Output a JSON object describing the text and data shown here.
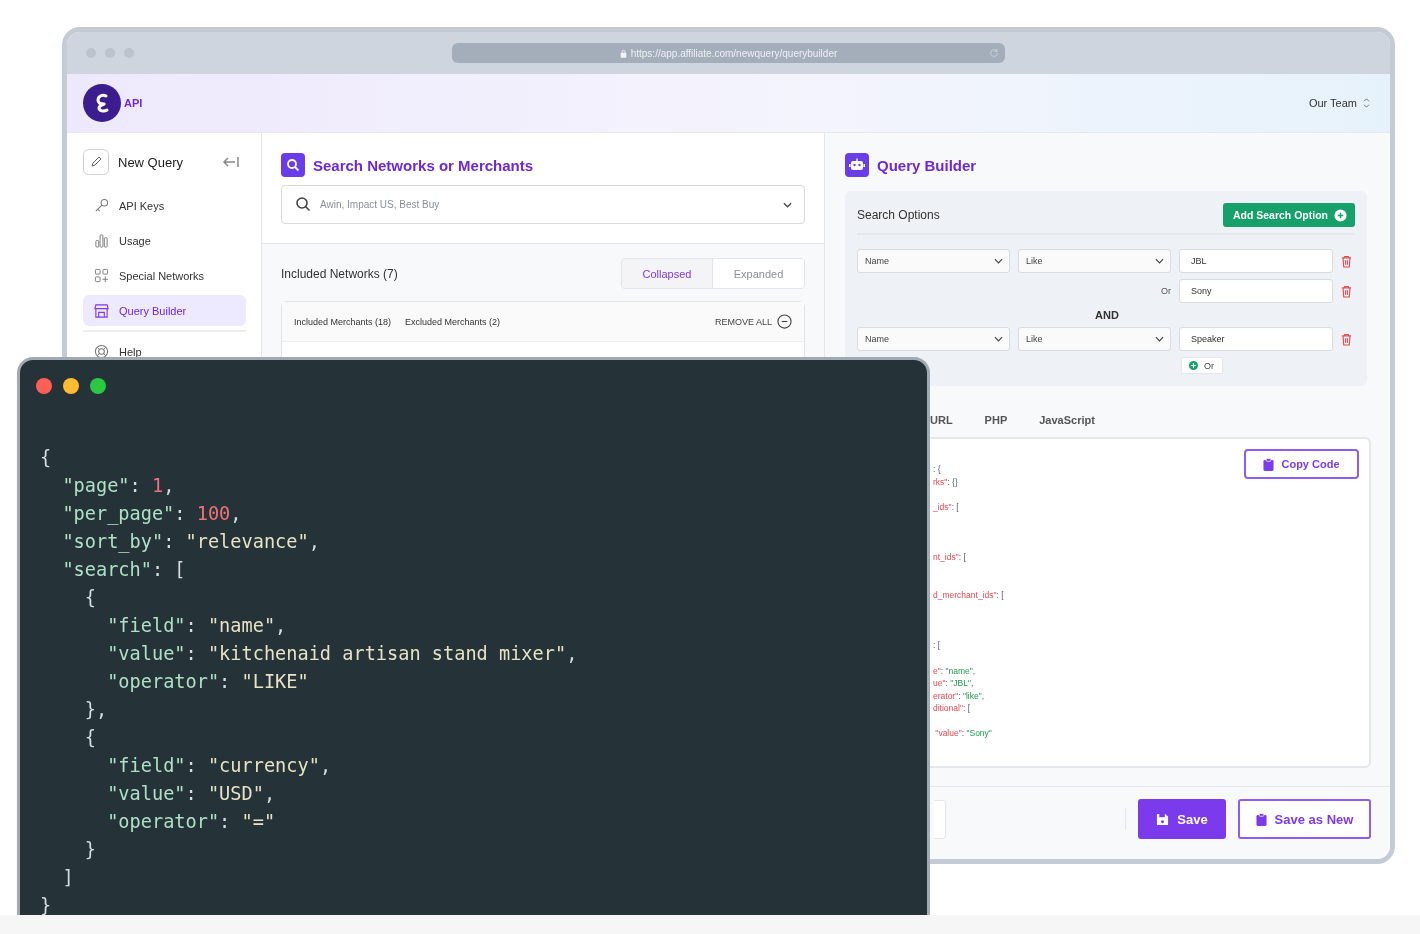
{
  "browser": {
    "url": "https://app.affiliate.com/newquery/querybuilder"
  },
  "header": {
    "logo_text": "API",
    "team": "Our Team"
  },
  "sidebar": {
    "new_query": "New Query",
    "items": [
      {
        "label": "API Keys",
        "selected": false
      },
      {
        "label": "Usage",
        "selected": false
      },
      {
        "label": "Special Networks",
        "selected": false
      },
      {
        "label": "Query Builder",
        "selected": true
      },
      {
        "label": "Help",
        "selected": false
      }
    ]
  },
  "networks_panel": {
    "title": "Search Networks or Merchants",
    "search": {
      "placeholder": "Awin, Impact US, Best Buy"
    },
    "included_title": "Included Networks (7)",
    "view_toggle": [
      {
        "label": "Collapsed",
        "selected": true
      },
      {
        "label": "Expanded",
        "selected": false
      }
    ],
    "merchant_tabs": [
      "Included Merchants (18)",
      "Excluded Merchants (2)"
    ],
    "remove_all": "REMOVE ALL"
  },
  "query_builder": {
    "title": "Query Builder",
    "search_options": {
      "title": "Search Options",
      "add_button": "Add Search Option",
      "groups": [
        {
          "field": "Name",
          "operator": "Like",
          "value": "JBL",
          "alternatives": [
            {
              "label": "Or",
              "value": "Sony"
            }
          ]
        },
        {
          "joiner": "AND",
          "field": "Name",
          "operator": "Like",
          "value": "Speaker",
          "add_or": "Or"
        }
      ]
    },
    "code_tabs": [
      "URL",
      "PHP",
      "JavaScript"
    ],
    "copy_button": "Copy Code",
    "code_lines": [
      {
        "kind": "code",
        "tokens": [
          {
            "kind": "punct",
            "text": ": {"
          }
        ]
      },
      {
        "kind": "code",
        "tokens": [
          {
            "kind": "key",
            "text": "rks\""
          },
          {
            "kind": "punct",
            "text": ": {}"
          }
        ]
      },
      {
        "kind": "blank"
      },
      {
        "kind": "code",
        "tokens": [
          {
            "kind": "key",
            "text": "_ids\""
          },
          {
            "kind": "punct",
            "text": ": ["
          }
        ]
      },
      {
        "kind": "blank"
      },
      {
        "kind": "blank"
      },
      {
        "kind": "blank"
      },
      {
        "kind": "code",
        "tokens": [
          {
            "kind": "key",
            "text": "nt_ids\""
          },
          {
            "kind": "punct",
            "text": ": ["
          }
        ]
      },
      {
        "kind": "blank"
      },
      {
        "kind": "blank"
      },
      {
        "kind": "code",
        "tokens": [
          {
            "kind": "key",
            "text": "d_merchant_ids\""
          },
          {
            "kind": "punct",
            "text": ": ["
          }
        ]
      },
      {
        "kind": "blank"
      },
      {
        "kind": "blank"
      },
      {
        "kind": "blank"
      },
      {
        "kind": "code",
        "tokens": [
          {
            "kind": "punct",
            "text": ": ["
          }
        ]
      },
      {
        "kind": "blank"
      },
      {
        "kind": "code",
        "tokens": [
          {
            "kind": "key",
            "text": "e\""
          },
          {
            "kind": "punct",
            "text": ": "
          },
          {
            "kind": "string",
            "text": "\"name\""
          },
          {
            "kind": "punct",
            "text": ","
          }
        ]
      },
      {
        "kind": "code",
        "tokens": [
          {
            "kind": "key",
            "text": "ue\""
          },
          {
            "kind": "punct",
            "text": ": "
          },
          {
            "kind": "string",
            "text": "\"JBL\""
          },
          {
            "kind": "punct",
            "text": ","
          }
        ]
      },
      {
        "kind": "code",
        "tokens": [
          {
            "kind": "key",
            "text": "erator\""
          },
          {
            "kind": "punct",
            "text": ": "
          },
          {
            "kind": "string",
            "text": "\"like\""
          },
          {
            "kind": "punct",
            "text": ","
          }
        ]
      },
      {
        "kind": "code",
        "tokens": [
          {
            "kind": "key",
            "text": "ditional\""
          },
          {
            "kind": "punct",
            "text": ": ["
          }
        ]
      },
      {
        "kind": "blank"
      },
      {
        "kind": "code",
        "tokens": [
          {
            "kind": "key",
            "text": " \"value\""
          },
          {
            "kind": "punct",
            "text": ": "
          },
          {
            "kind": "string",
            "text": "\"Sony\""
          }
        ]
      }
    ],
    "save_button": "Save",
    "save_as_new_button": "Save as New"
  },
  "code_window": {
    "lines": [
      [
        {
          "kind": "punct",
          "text": "{"
        }
      ],
      [
        {
          "kind": "key",
          "text": "\"page\""
        },
        {
          "kind": "punct",
          "text": ": "
        },
        {
          "kind": "number",
          "text": "1"
        },
        {
          "kind": "punct",
          "text": ","
        }
      ],
      [
        {
          "kind": "key",
          "text": "\"per_page\""
        },
        {
          "kind": "punct",
          "text": ": "
        },
        {
          "kind": "number",
          "text": "100"
        },
        {
          "kind": "punct",
          "text": ","
        }
      ],
      [
        {
          "kind": "key",
          "text": "\"sort_by\""
        },
        {
          "kind": "punct",
          "text": ": "
        },
        {
          "kind": "string",
          "text": "\"relevance\""
        },
        {
          "kind": "punct",
          "text": ","
        }
      ],
      [
        {
          "kind": "key",
          "text": "\"search\""
        },
        {
          "kind": "punct",
          "text": ": ["
        }
      ],
      [
        {
          "kind": "punct",
          "text": "{"
        }
      ],
      [
        {
          "kind": "key",
          "text": "\"field\""
        },
        {
          "kind": "punct",
          "text": ": "
        },
        {
          "kind": "string",
          "text": "\"name\""
        },
        {
          "kind": "punct",
          "text": ","
        }
      ],
      [
        {
          "kind": "key",
          "text": "\"value\""
        },
        {
          "kind": "punct",
          "text": ": "
        },
        {
          "kind": "string",
          "text": "\"kitchenaid artisan stand mixer\""
        },
        {
          "kind": "punct",
          "text": ","
        }
      ],
      [
        {
          "kind": "key",
          "text": "\"operator\""
        },
        {
          "kind": "punct",
          "text": ": "
        },
        {
          "kind": "string",
          "text": "\"LIKE\""
        }
      ],
      [
        {
          "kind": "punct",
          "text": "},"
        }
      ],
      [
        {
          "kind": "punct",
          "text": "{"
        }
      ],
      [
        {
          "kind": "key",
          "text": "\"field\""
        },
        {
          "kind": "punct",
          "text": ": "
        },
        {
          "kind": "string",
          "text": "\"currency\""
        },
        {
          "kind": "punct",
          "text": ","
        }
      ],
      [
        {
          "kind": "key",
          "text": "\"value\""
        },
        {
          "kind": "punct",
          "text": ": "
        },
        {
          "kind": "string",
          "text": "\"USD\""
        },
        {
          "kind": "punct",
          "text": ","
        }
      ],
      [
        {
          "kind": "key",
          "text": "\"operator\""
        },
        {
          "kind": "punct",
          "text": ": "
        },
        {
          "kind": "string",
          "text": "\"=\""
        }
      ],
      [
        {
          "kind": "punct",
          "text": "}"
        }
      ],
      [
        {
          "kind": "punct",
          "text": "]"
        }
      ],
      [
        {
          "kind": "punct",
          "text": "}"
        }
      ]
    ]
  }
}
